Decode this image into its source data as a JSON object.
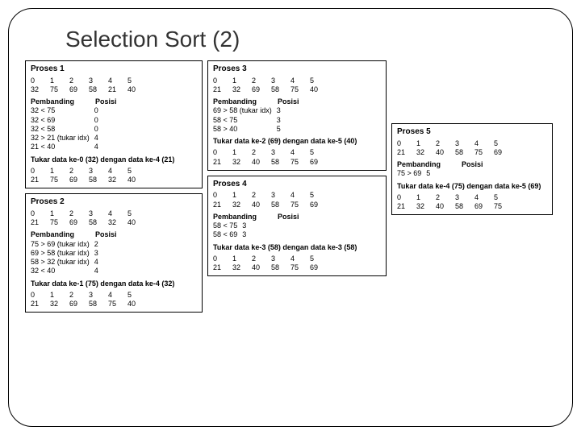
{
  "title": "Selection Sort (2)",
  "headers": {
    "cmp": "Pembanding",
    "pos": "Posisi"
  },
  "p1": {
    "title": "Proses 1",
    "idx": [
      "0",
      "1",
      "2",
      "3",
      "4",
      "5"
    ],
    "before": [
      "32",
      "75",
      "69",
      "58",
      "21",
      "40"
    ],
    "cmp": [
      [
        "32 < 75",
        "0"
      ],
      [
        "32 < 69",
        "0"
      ],
      [
        "32 < 58",
        "0"
      ],
      [
        "32 > 21 (tukar idx)",
        "4"
      ],
      [
        "21 < 40",
        "4"
      ]
    ],
    "swap": "Tukar data ke-0 (32) dengan data ke-4 (21)",
    "after": [
      "21",
      "75",
      "69",
      "58",
      "32",
      "40"
    ]
  },
  "p2": {
    "title": "Proses 2",
    "before": [
      "21",
      "75",
      "69",
      "58",
      "32",
      "40"
    ],
    "cmp": [
      [
        "75 > 69 (tukar idx)",
        "2"
      ],
      [
        "69 > 58 (tukar idx)",
        "3"
      ],
      [
        "58 > 32 (tukar idx)",
        "4"
      ],
      [
        "32 < 40",
        "4"
      ]
    ],
    "swap": "Tukar data ke-1 (75) dengan data ke-4 (32)",
    "after": [
      "21",
      "32",
      "69",
      "58",
      "75",
      "40"
    ]
  },
  "p3": {
    "title": "Proses 3",
    "before": [
      "21",
      "32",
      "69",
      "58",
      "75",
      "40"
    ],
    "cmp": [
      [
        "69 > 58 (tukar idx)",
        "3"
      ],
      [
        "58 < 75",
        "3"
      ],
      [
        "58 > 40",
        "5"
      ]
    ],
    "swap": "Tukar data ke-2 (69) dengan data ke-5 (40)",
    "after": [
      "21",
      "32",
      "40",
      "58",
      "75",
      "69"
    ]
  },
  "p4": {
    "title": "Proses 4",
    "before": [
      "21",
      "32",
      "40",
      "58",
      "75",
      "69"
    ],
    "cmp": [
      [
        "58 < 75",
        "3"
      ],
      [
        "58 < 69",
        "3"
      ]
    ],
    "swap": "Tukar data ke-3 (58) dengan data ke-3 (58)",
    "after": [
      "21",
      "32",
      "40",
      "58",
      "75",
      "69"
    ]
  },
  "p5": {
    "title": "Proses 5",
    "before": [
      "21",
      "32",
      "40",
      "58",
      "75",
      "69"
    ],
    "cmp": [
      [
        "75 > 69",
        "5"
      ]
    ],
    "swap": "Tukar data ke-4 (75) dengan data ke-5 (69)",
    "after": [
      "21",
      "32",
      "40",
      "58",
      "69",
      "75"
    ]
  }
}
